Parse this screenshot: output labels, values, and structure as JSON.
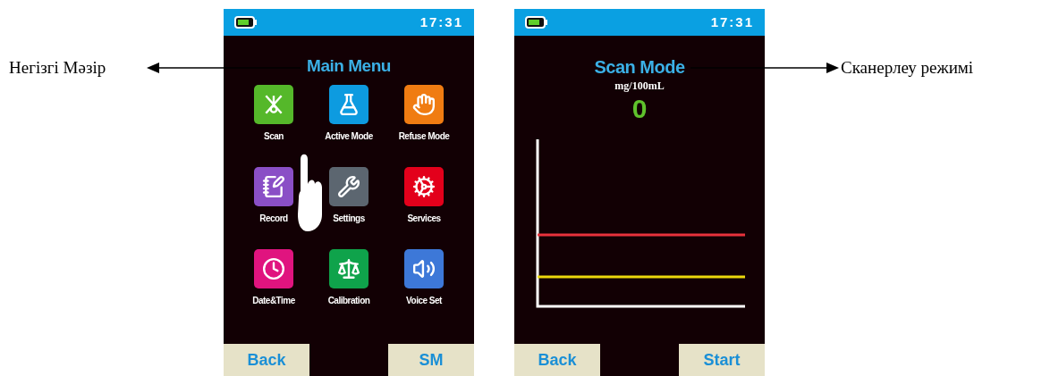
{
  "left_annotation": "Негізгі Мәзір",
  "screens": [
    {
      "kind": "menu",
      "status_bar": {
        "time": "17:31"
      },
      "title": "Main Menu",
      "menu_items": [
        {
          "label": "Scan",
          "color": "#55b82a"
        },
        {
          "label": "Active Mode",
          "color": "#0d9be0"
        },
        {
          "label": "Refuse Mode",
          "color": "#f07c12"
        },
        {
          "label": "Record",
          "color": "#8a4fc6"
        },
        {
          "label": "Settings",
          "color": "#5c6670"
        },
        {
          "label": "Services",
          "color": "#e3001b"
        },
        {
          "label": "Date&Time",
          "color": "#e0147f"
        },
        {
          "label": "Calibration",
          "color": "#0fa34b"
        },
        {
          "label": "Voice Set",
          "color": "#3d78d8"
        }
      ],
      "buttons": [
        "Back",
        "SM"
      ]
    },
    {
      "kind": "scan",
      "status_bar": {
        "time": "17:31"
      },
      "title": "Scan Mode",
      "unit": "mg/100mL",
      "reading": "0",
      "buttons": [
        "Back",
        "Start"
      ]
    }
  ],
  "right_annotation": "Сканерлеу режимі"
}
